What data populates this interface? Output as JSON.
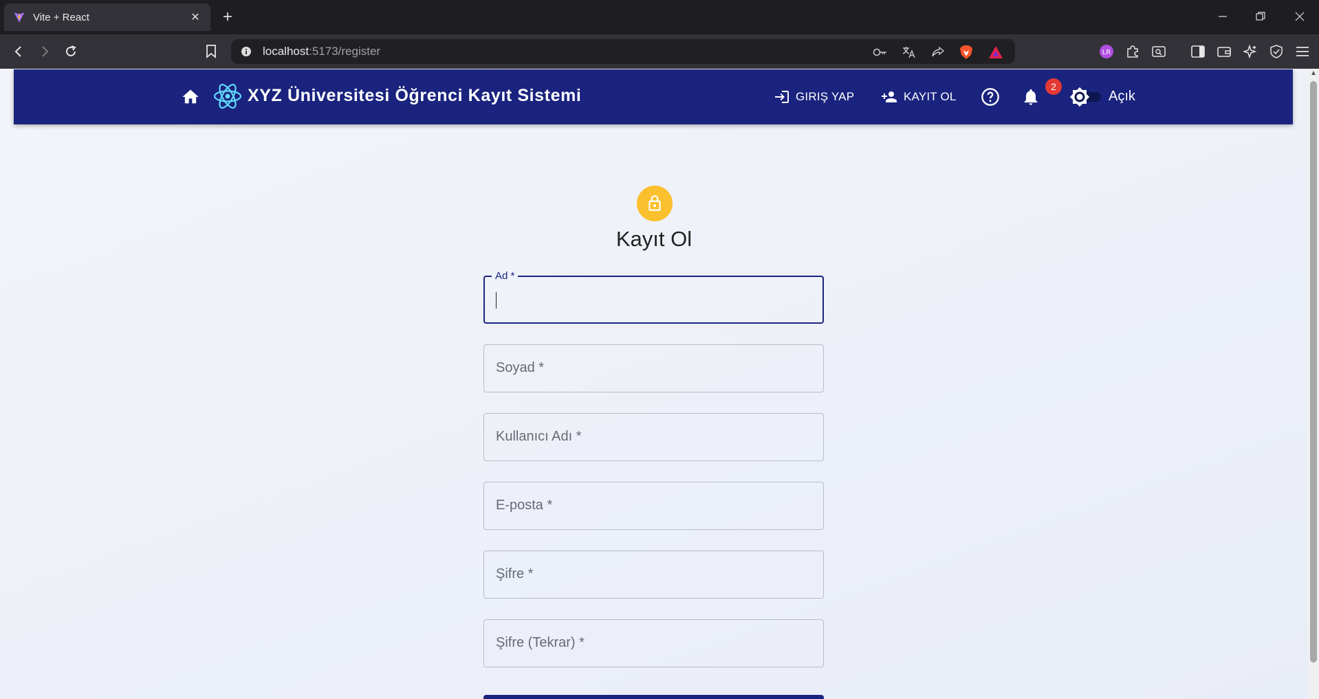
{
  "browser": {
    "tab_title": "Vite + React",
    "url_host": "localhost",
    "url_path": ":5173/register",
    "new_tab": "+"
  },
  "app": {
    "brand": "XYZ Üniversitesi Öğrenci Kayıt Sistemi",
    "nav": {
      "login": "GIRIŞ YAP",
      "register": "KAYIT OL"
    },
    "notifications_count": "2",
    "theme_label": "Açık",
    "colors": {
      "appbar": "#1a237e",
      "avatar": "#fbc02d",
      "badge": "#e53935"
    }
  },
  "form": {
    "title": "Kayıt Ol",
    "fields": [
      {
        "label": "Ad *",
        "value": "",
        "focused": true
      },
      {
        "label": "Soyad *",
        "value": ""
      },
      {
        "label": "Kullanıcı Adı *",
        "value": ""
      },
      {
        "label": "E-posta *",
        "value": ""
      },
      {
        "label": "Şifre *",
        "value": ""
      },
      {
        "label": "Şifre (Tekrar) *",
        "value": ""
      }
    ]
  }
}
